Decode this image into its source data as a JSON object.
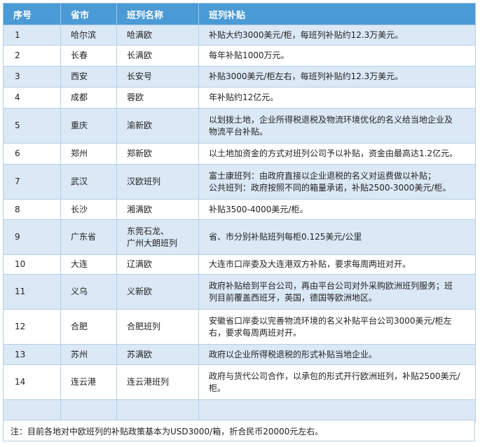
{
  "table": {
    "headers": [
      "序号",
      "省市",
      "班列名称",
      "班列补贴"
    ],
    "rows": [
      {
        "no": "1",
        "city": "哈尔滨",
        "train": "哈满欧",
        "subsidy": "补贴大约3000美元/柜，每班列补贴约12.3万美元。"
      },
      {
        "no": "2",
        "city": "长春",
        "train": "长满欧",
        "subsidy": "每年补贴1000万元。"
      },
      {
        "no": "3",
        "city": "西安",
        "train": "长安号",
        "subsidy": "补贴3000美元/柜左右，每班列补贴约12.3万美元。"
      },
      {
        "no": "4",
        "city": "成都",
        "train": "蓉欧",
        "subsidy": "年补贴约12亿元。"
      },
      {
        "no": "5",
        "city": "重庆",
        "train": "渝新欧",
        "subsidy": "以划拨土地，企业所得税退税及物流环境优化的名义给当地企业及\n物流平台补贴。"
      },
      {
        "no": "6",
        "city": "郑州",
        "train": "郑新欧",
        "subsidy": "以土地加资金的方式对班列公司予以补贴，资金由最高达1.2亿元。"
      },
      {
        "no": "7",
        "city": "武汉",
        "train": "汉欧班列",
        "subsidy": "富士康班列：由政府直接以企业退税的名义对运费做以补贴；\n公共班列：政府按照不同的箱量承诺，补贴2500-3000美元/柜。"
      },
      {
        "no": "8",
        "city": "长沙",
        "train": "湘满欧",
        "subsidy": "补贴3500-4000美元/柜。"
      },
      {
        "no": "9",
        "city": "广东省",
        "train": "东莞石龙、\n广州大朗班列",
        "subsidy": "省、市分别补贴班列每柜0.125美元/公里"
      },
      {
        "no": "10",
        "city": "大连",
        "train": "辽满欧",
        "subsidy": "大连市口岸委及大连港双方补贴，要求每周两班对开。"
      },
      {
        "no": "11",
        "city": "义乌",
        "train": "义新欧",
        "subsidy": "政府补贴给到平台公司，再由平台公司对外采购欧洲班列服务；班\n列目前覆盖西班牙，英国，德国等欧洲地区。"
      },
      {
        "no": "12",
        "city": "合肥",
        "train": "合肥班列",
        "subsidy": "安徽省口岸委以完善物流环境的名义补贴平台公司3000美元/柜左\n右，要求每周两班对开。"
      },
      {
        "no": "13",
        "city": "苏州",
        "train": "苏满欧",
        "subsidy": "政府以企业所得税退税的形式补贴当地企业。"
      },
      {
        "no": "14",
        "city": "连云港",
        "train": "连云港班列",
        "subsidy": "政府与货代公司合作，以承包的形式开行欧洲班列，补贴2500美元/\n柜。"
      }
    ]
  },
  "note": "注：目前各地对中欧班列的补贴政策基本为USD3000/箱，折合民币20000元左右。"
}
